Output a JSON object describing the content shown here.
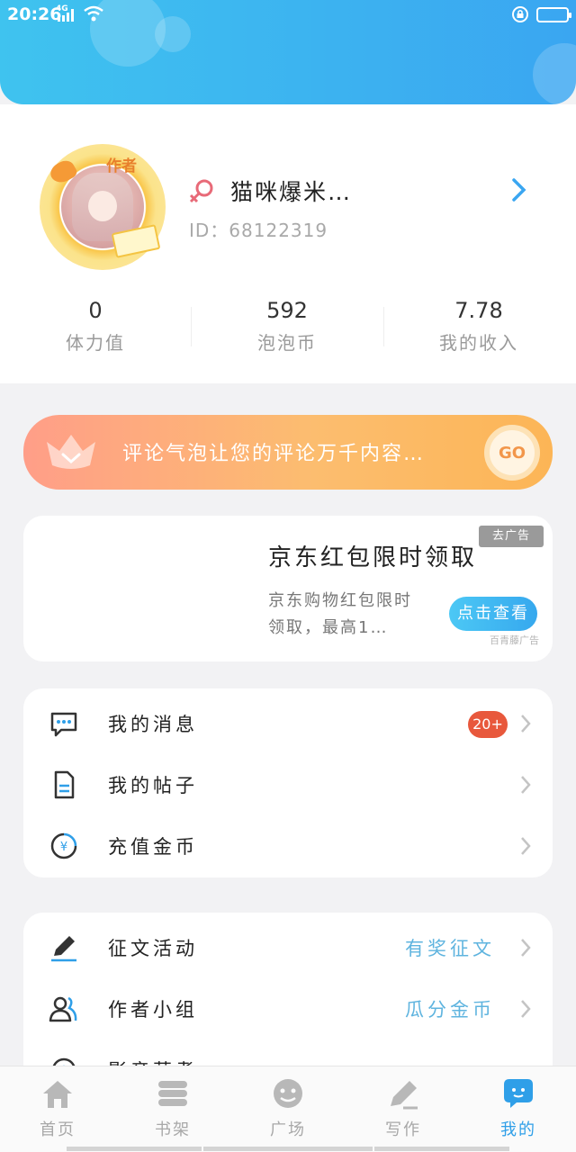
{
  "status_bar": {
    "time": "20:26",
    "network": "4G"
  },
  "profile": {
    "avatar_badge": "作者",
    "nickname": "猫咪爆米…",
    "id_text": "ID：68122319",
    "stats": [
      {
        "value": "0",
        "label": "体力值"
      },
      {
        "value": "592",
        "label": "泡泡币"
      },
      {
        "value": "7.78",
        "label": "我的收入"
      }
    ]
  },
  "promo": {
    "text": "评论气泡让您的评论万千内容…",
    "button_label": "GO"
  },
  "ad": {
    "remove_label": "去广告",
    "title": "京东红包限时领取",
    "description": "京东购物红包限时领取，最高1…",
    "button_label": "点击查看",
    "source": "百青藤广告"
  },
  "menu_group_1": {
    "items": [
      {
        "icon": "message-icon",
        "label": "我的消息",
        "badge": "20+"
      },
      {
        "icon": "document-icon",
        "label": "我的帖子"
      },
      {
        "icon": "coin-icon",
        "label": "充值金币"
      }
    ]
  },
  "menu_group_2": {
    "items": [
      {
        "icon": "pen-icon",
        "label": "征文活动",
        "extra": "有奖征文"
      },
      {
        "icon": "group-icon",
        "label": "作者小组",
        "extra": "瓜分金币"
      },
      {
        "icon": "clock-icon",
        "label": "影音蒸煮"
      }
    ]
  },
  "tabbar": {
    "active": "我的",
    "tabs": [
      {
        "icon": "home-icon",
        "label": "首页"
      },
      {
        "icon": "bookshelf-icon",
        "label": "书架"
      },
      {
        "icon": "square-icon",
        "label": "广场"
      },
      {
        "icon": "write-icon",
        "label": "写作"
      },
      {
        "icon": "mine-icon",
        "label": "我的"
      }
    ]
  },
  "colors": {
    "header_start": "#3fc3ef",
    "header_end": "#3aa6f1",
    "accent_blue": "#2f9fe8",
    "badge_red": "#e8583c",
    "promo_start": "#ff9e88",
    "promo_end": "#fcb556"
  }
}
